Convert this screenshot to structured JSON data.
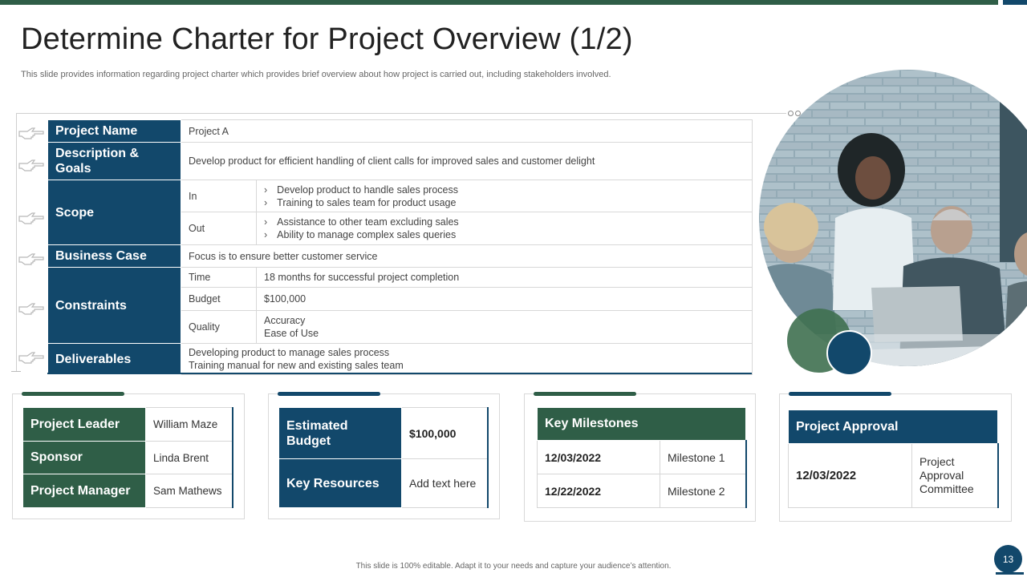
{
  "slide": {
    "title": "Determine Charter for Project Overview (1/2)",
    "subtitle": "This slide provides information regarding project charter which provides brief overview about how project is carried out, including stakeholders involved.",
    "footer": "This slide is 100% editable. Adapt it to your needs and capture your audience’s attention.",
    "page_number": "13"
  },
  "charter": {
    "project_name_label": "Project Name",
    "project_name_value": "Project A",
    "description_label": "Description & Goals",
    "description_value": "Develop  product for efficient  handling of client calls for improved  sales and customer delight",
    "scope_label": "Scope",
    "scope_in_label": "In",
    "scope_in_items": [
      "Develop  product to handle sales process",
      "Training  to sales team for product usage"
    ],
    "scope_out_label": "Out",
    "scope_out_items": [
      "Assistance to other team excluding sales",
      "Ability to manage complex sales queries"
    ],
    "business_case_label": "Business Case",
    "business_case_value": "Focus is to ensure better customer service",
    "constraints_label": "Constraints",
    "time_label": "Time",
    "time_value": "18 months for  successful project  completion",
    "budget_label": "Budget",
    "budget_value": "$100,000",
    "quality_label": "Quality",
    "quality_values": [
      "Accuracy",
      "Ease of Use"
    ],
    "deliverables_label": "Deliverables",
    "deliverables_values": [
      "Developing  product to manage  sales process",
      "Training  manual for new and existing sales team"
    ],
    "bullet_marker": "›"
  },
  "people": {
    "leader_label": "Project Leader",
    "leader_value": "William Maze",
    "sponsor_label": "Sponsor",
    "sponsor_value": "Linda Brent",
    "manager_label": "Project Manager",
    "manager_value": "Sam Mathews"
  },
  "budget_card": {
    "estimated_label": "Estimated Budget",
    "estimated_value": "$100,000",
    "resources_label": "Key Resources",
    "resources_value": "Add text here"
  },
  "milestones": {
    "header": "Key Milestones",
    "rows": [
      {
        "date": "12/03/2022",
        "name": "Milestone  1"
      },
      {
        "date": "12/22/2022",
        "name": "Milestone  2"
      }
    ]
  },
  "approval": {
    "header": "Project Approval",
    "date": "12/03/2022",
    "by": "Project Approval Committee"
  },
  "colors": {
    "navy": "#12486b",
    "green": "#2f5e47"
  },
  "icons": {
    "rail_icon": "pointing-hand-icon"
  }
}
